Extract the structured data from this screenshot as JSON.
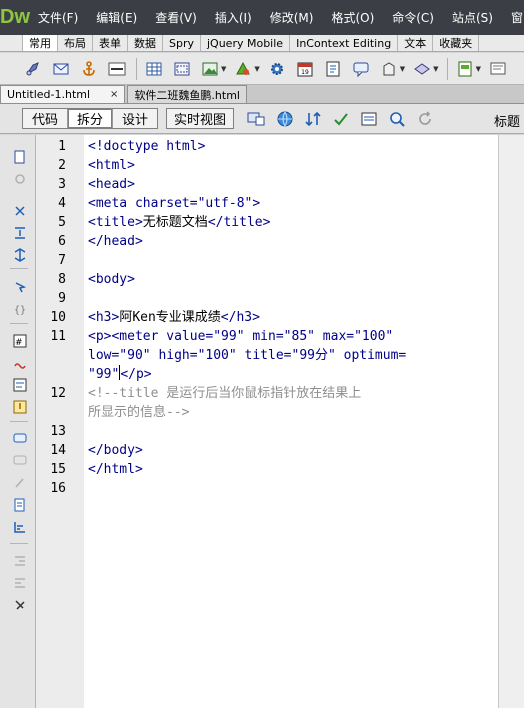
{
  "app": {
    "logo": "Dw"
  },
  "menu": [
    "文件(F)",
    "编辑(E)",
    "查看(V)",
    "插入(I)",
    "修改(M)",
    "格式(O)",
    "命令(C)",
    "站点(S)",
    "窗"
  ],
  "insert_tabs": [
    "常用",
    "布局",
    "表单",
    "数据",
    "Spry",
    "jQuery Mobile",
    "InContext Editing",
    "文本",
    "收藏夹"
  ],
  "active_insert_tab": "常用",
  "doc_tabs": [
    {
      "label": "Untitled-1.html",
      "close": "×"
    },
    {
      "label": "软件二班魏鱼鹏.html",
      "close": ""
    }
  ],
  "view_buttons": [
    "代码",
    "拆分",
    "设计"
  ],
  "active_view": "拆分",
  "live_view_label": "实时视图",
  "title_label": "标题",
  "line_numbers": [
    "1",
    "2",
    "3",
    "4",
    "5",
    "6",
    "7",
    "8",
    "9",
    "10",
    "11",
    "",
    "",
    "12",
    "",
    "13",
    "14",
    "15",
    "16"
  ],
  "code": {
    "l1": "<!doctype html>",
    "l2": "<html>",
    "l3": "<head>",
    "l4": "<meta charset=\"utf-8\">",
    "l5a": "<title>",
    "l5b": "无标题文档",
    "l5c": "</title>",
    "l6": "</head>",
    "l8": "<body>",
    "l10a": "<h3>",
    "l10b": "阿Ken专业课成绩",
    "l10c": "</h3>",
    "l11a": "<p><meter value=\"99\" min=\"85\" max=\"100\"",
    "l11b": "low=\"90\" high=\"100\" title=\"99分\" optimum=",
    "l11c": "\"99\"",
    "l11d": "</p>",
    "l12a": "<!--title 是运行后当你鼠标指针放在结果上",
    "l12b": "所显示的信息-->",
    "l14": "</body>",
    "l15": "</html>"
  }
}
